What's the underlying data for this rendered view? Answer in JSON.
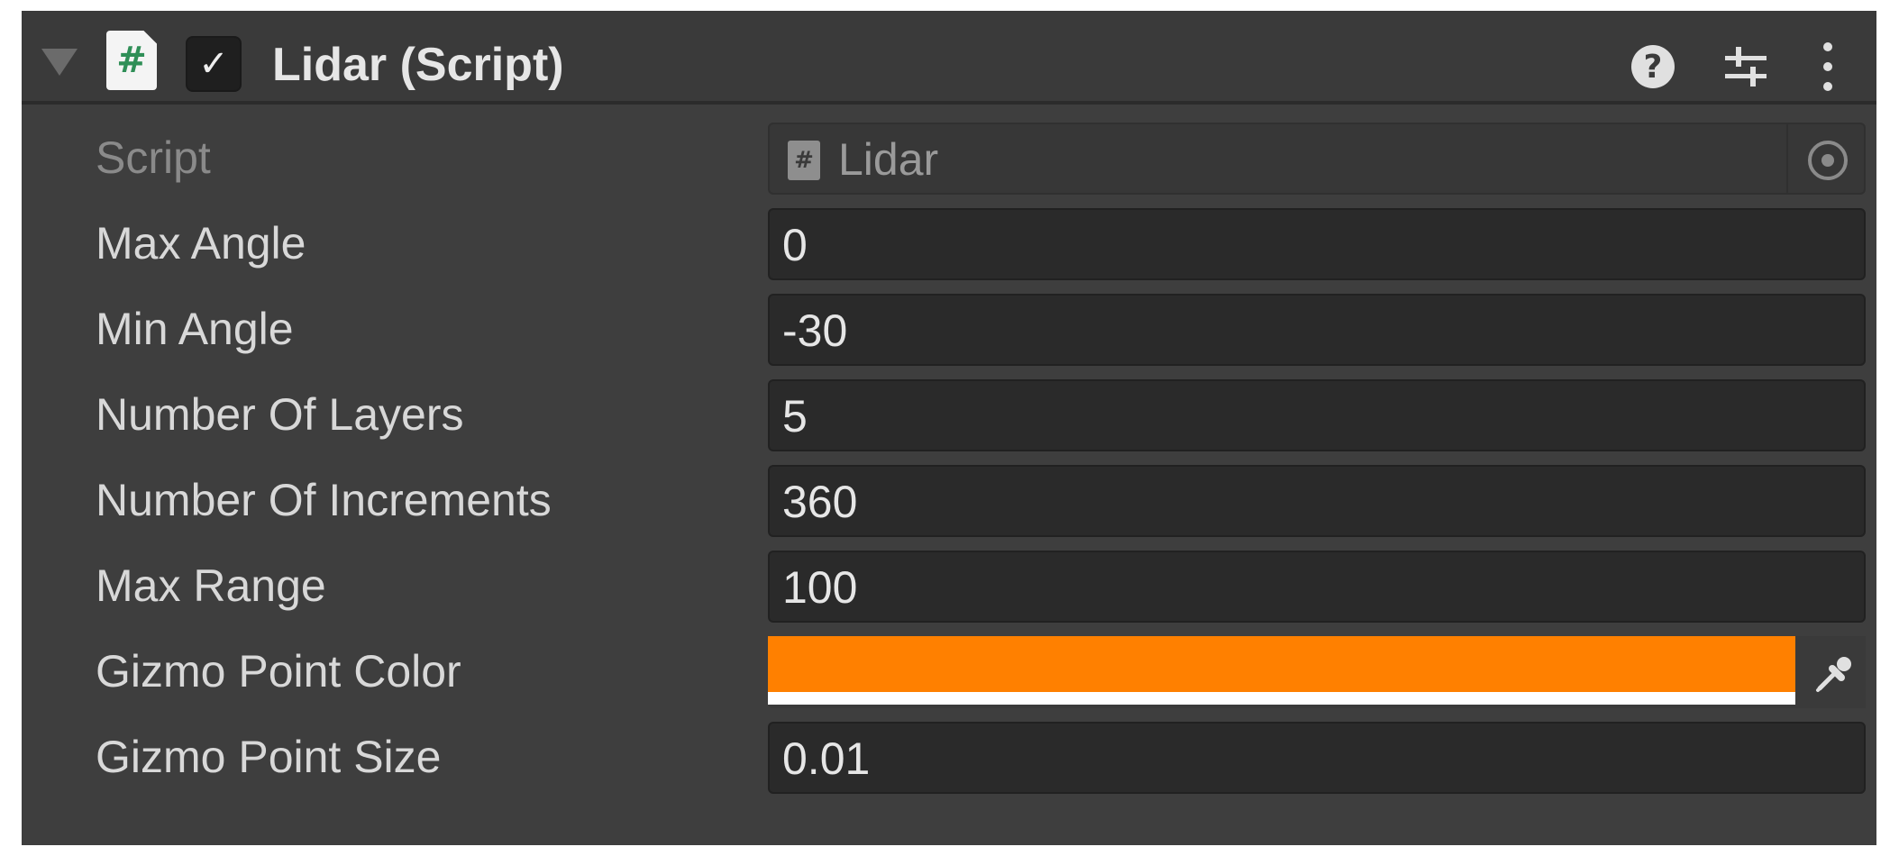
{
  "component": {
    "title": "Lidar (Script)",
    "enabled": true,
    "script_icon_glyph": "#",
    "checkbox_glyph": "✓",
    "help_glyph": "?"
  },
  "icons": {
    "fold": "triangle-down-icon",
    "script": "csharp-script-icon",
    "help": "help-icon",
    "presets": "sliders-icon",
    "menu": "kebab-menu-icon",
    "object_picker": "object-picker-icon",
    "eyedropper": "eyedropper-icon"
  },
  "fields": [
    {
      "label": "Script",
      "value": "Lidar",
      "type": "object",
      "disabled": true
    },
    {
      "label": "Max Angle",
      "value": "0",
      "type": "number"
    },
    {
      "label": "Min Angle",
      "value": "-30",
      "type": "number"
    },
    {
      "label": "Number Of Layers",
      "value": "5",
      "type": "number"
    },
    {
      "label": "Number Of Increments",
      "value": "360",
      "type": "number"
    },
    {
      "label": "Max Range",
      "value": "100",
      "type": "number"
    },
    {
      "label": "Gizmo Point Color",
      "value": "#ff8000",
      "type": "color",
      "alpha": 1.0
    },
    {
      "label": "Gizmo Point Size",
      "value": "0.01",
      "type": "number"
    }
  ],
  "colors": {
    "panel_bg": "#3e3e3e",
    "header_bg": "#3a3a3a",
    "field_bg": "#2a2a2a",
    "label_text": "#d8d8d8",
    "disabled_text": "#8a8a8a",
    "gizmo_color": "#ff8000"
  }
}
